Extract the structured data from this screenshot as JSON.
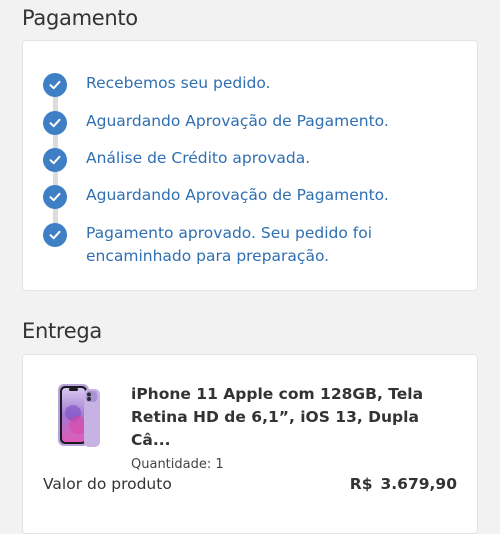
{
  "payment": {
    "title": "Pagamento",
    "steps": [
      {
        "label": "Recebemos seu pedido."
      },
      {
        "label": "Aguardando Aprovação de Pagamento."
      },
      {
        "label": "Análise de Crédito aprovada."
      },
      {
        "label": "Aguardando Aprovação de Pagamento."
      },
      {
        "label": "Pagamento aprovado. Seu pedido foi encaminhado para preparação."
      }
    ]
  },
  "delivery": {
    "title": "Entrega",
    "product": {
      "name": "iPhone 11 Apple com 128GB, Tela Retina HD de 6,1”, iOS 13, Dupla Câ...",
      "quantity": "Quantidade: 1",
      "image_icon": "purple-iphone-image"
    },
    "total": {
      "label": "Valor do produto",
      "currency": "R$",
      "value": "3.679,90"
    }
  },
  "colors": {
    "accent": "#3f7fc5",
    "accent_text": "#2f6fb2"
  }
}
